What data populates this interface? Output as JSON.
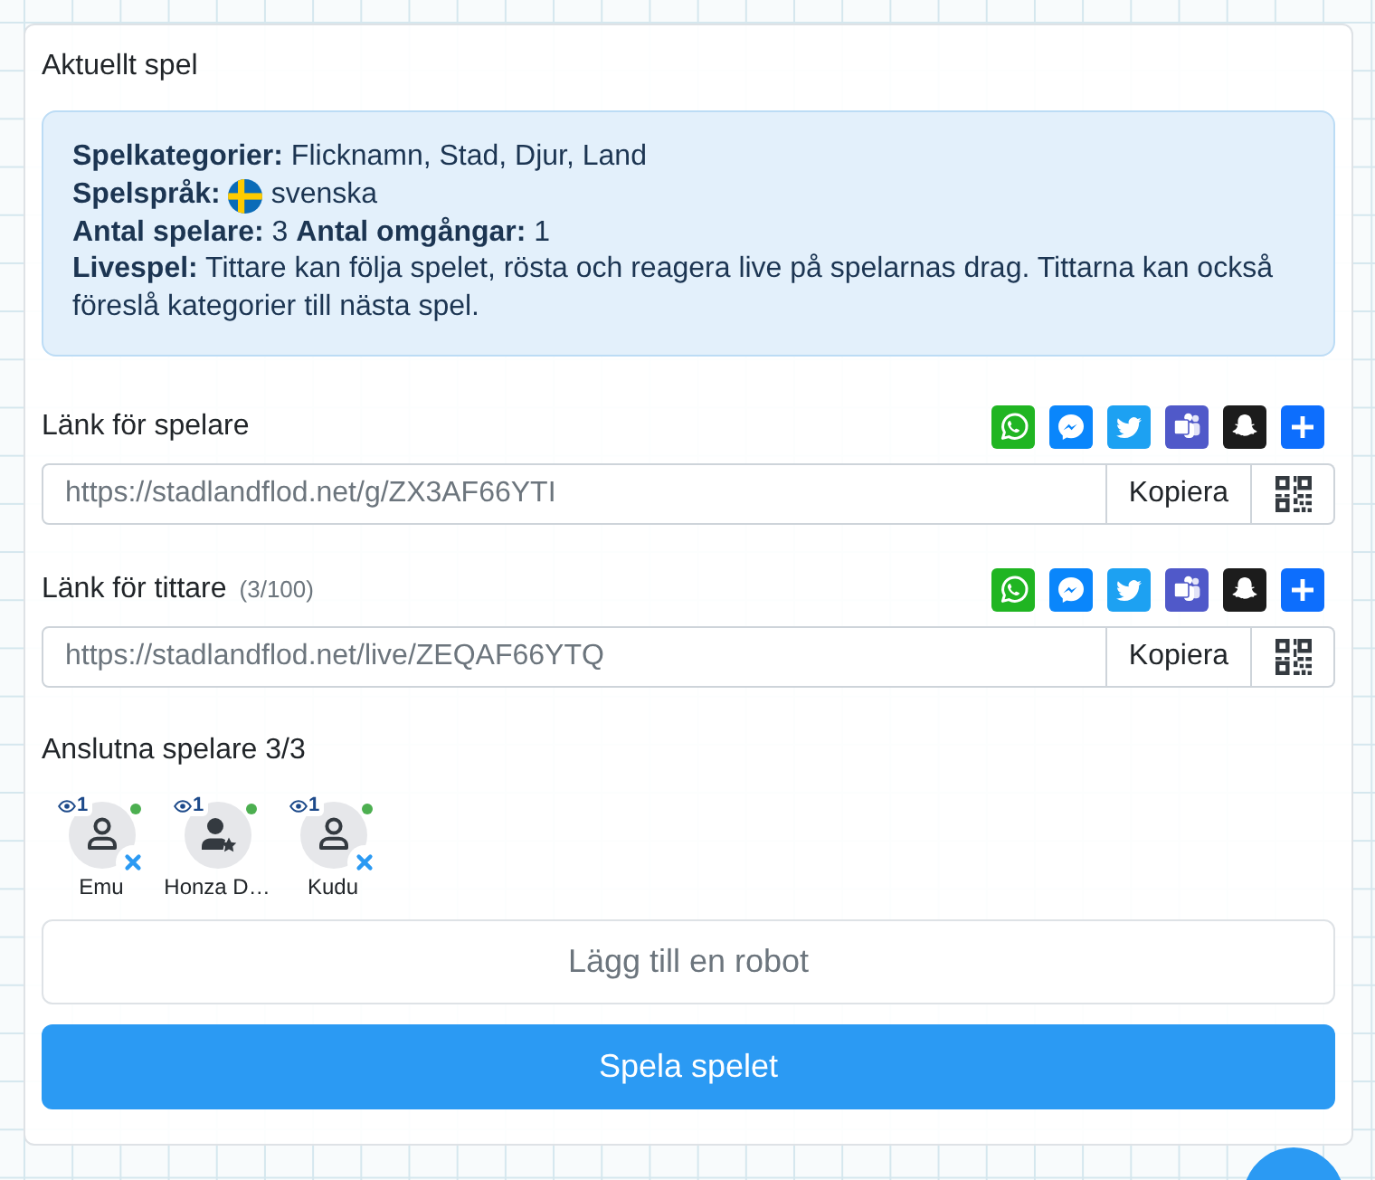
{
  "panel": {
    "title": "Aktuellt spel"
  },
  "game_info": [
    {
      "kind": "text",
      "text": "**Spelkategorier:** Flicknamn, Stad, Djur, Land"
    },
    {
      "kind": "language",
      "label": "Spelspråk:",
      "value": "svenska"
    },
    {
      "kind": "text",
      "text": "**Antal spelare:** 3 **Antal omgångar:** 1"
    },
    {
      "kind": "text",
      "text": "**Livespel:** Tittare kan följa spelet, rösta och reagera live på spelarnas drag. Tittarna kan också föreslå kategorier till nästa spel."
    }
  ],
  "links": [
    {
      "label": "Länk för spelare",
      "value": "https://stadlandflod.net/g/ZX3AF66YTI",
      "copy_button": "Kopiera",
      "share_buttons": [
        {
          "kind": "whatsapp"
        },
        {
          "kind": "messenger"
        },
        {
          "kind": "twitter"
        },
        {
          "kind": "teams"
        },
        {
          "kind": "snapchat"
        },
        {
          "kind": "more"
        }
      ]
    },
    {
      "label": "Länk för tittare",
      "count": "(3/100)",
      "value": "https://stadlandflod.net/live/ZEQAF66YTQ",
      "copy_button": "Kopiera",
      "share_buttons": [
        {
          "kind": "whatsapp"
        },
        {
          "kind": "messenger"
        },
        {
          "kind": "twitter"
        },
        {
          "kind": "teams"
        },
        {
          "kind": "snapchat"
        },
        {
          "kind": "more"
        }
      ]
    }
  ],
  "players": {
    "heading": "Anslutna spelare 3/3",
    "items": [
      {
        "name": "Emu",
        "viewers": "1",
        "online": true,
        "host": false,
        "removable": true
      },
      {
        "name": "Honza D…",
        "viewers": "1",
        "online": true,
        "host": true,
        "removable": false
      },
      {
        "name": "Kudu",
        "viewers": "1",
        "online": true,
        "host": false,
        "removable": true
      }
    ]
  },
  "buttons": {
    "add_robot": "Lägg till en robot",
    "start": "Spela spelet"
  }
}
